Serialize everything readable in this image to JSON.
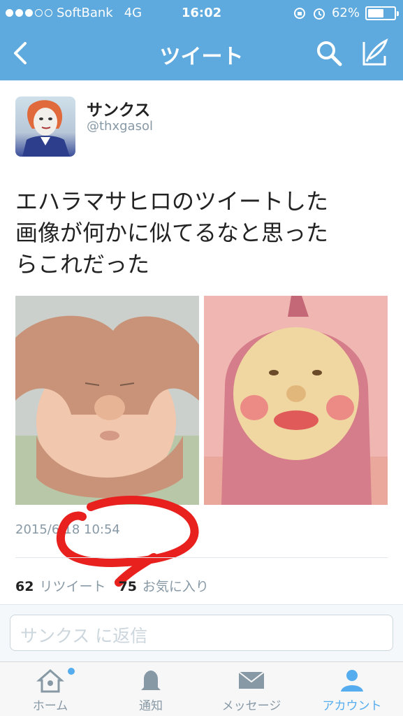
{
  "status": {
    "carrier": "SoftBank",
    "network": "4G",
    "time": "16:02",
    "battery": "62%",
    "battery_level": 0.62
  },
  "nav": {
    "title": "ツイート",
    "back_icon": "chevron-left-icon",
    "search_icon": "search-icon",
    "compose_icon": "compose-icon"
  },
  "tweet": {
    "name": "サンクス",
    "handle": "@thxgasol",
    "text": "エハラマサヒロのツイートした画像が何かに似てるなと思ったらこれだった",
    "text_lines": [
      "エハラマサヒロのツイートした",
      "画像が何かに似てるなと思った",
      "らこれだった"
    ],
    "timestamp": "2015/6/18 10:54",
    "retweets": "62",
    "retweets_label": "リツイート",
    "favorites": "75",
    "favorites_label": "お気に入り"
  },
  "reply": {
    "placeholder": "サンクス に返信"
  },
  "tabs": [
    {
      "label": "ホーム",
      "icon": "home-icon",
      "active": false
    },
    {
      "label": "通知",
      "icon": "bell-icon",
      "active": false
    },
    {
      "label": "メッセージ",
      "icon": "envelope-icon",
      "active": false
    },
    {
      "label": "アカウント",
      "icon": "person-icon",
      "active": true
    }
  ],
  "colors": {
    "header": "#5ea9dd",
    "accent": "#55acee",
    "annotation": "#e8201e"
  }
}
